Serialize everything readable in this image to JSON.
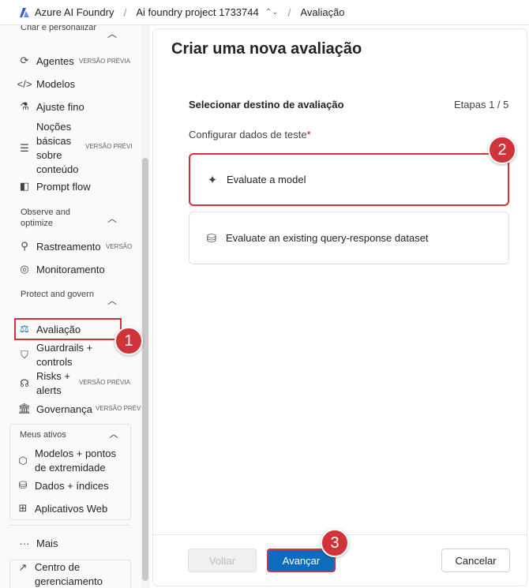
{
  "topbar": {
    "app_name": "Azure AI Foundry",
    "project": "Ai foundry project 1733744",
    "page": "Avaliação"
  },
  "sidebar": {
    "section_build": "Criar e personalizar",
    "items_build": [
      {
        "label": "Agentes",
        "badge": "VERSÃO PRÉVIA",
        "icon": "agents-icon"
      },
      {
        "label": "Modelos",
        "icon": "code-icon"
      },
      {
        "label": "Ajuste fino",
        "icon": "flask-icon"
      },
      {
        "label": "Noções básicas sobre conteúdo",
        "badge": "VERSÃO PRÉVI",
        "icon": "content-icon"
      },
      {
        "label": "Prompt flow",
        "icon": "prompt-flow-icon"
      }
    ],
    "section_observe": "Observe and optimize",
    "items_observe": [
      {
        "label": "Rastreamento",
        "badge": "VERSÃO",
        "icon": "tracing-icon"
      },
      {
        "label": "Monitoramento",
        "icon": "monitor-icon"
      }
    ],
    "section_protect": "Protect and govern",
    "items_protect": [
      {
        "label": "Avaliação",
        "icon": "scale-icon"
      },
      {
        "label": "Guardrails + controls",
        "icon": "shield-icon"
      },
      {
        "label": "Risks + alerts",
        "badge": "VERSÃO PRÉVIA",
        "icon": "risk-icon"
      },
      {
        "label": "Governança",
        "badge": "VERSÃO PRÉVI",
        "icon": "bank-icon"
      }
    ],
    "section_assets": "Meus ativos",
    "items_assets": [
      {
        "label": "Modelos + pontos de extremidade",
        "icon": "cube-icon"
      },
      {
        "label": "Dados + índices",
        "icon": "database-icon"
      },
      {
        "label": "Aplicativos Web",
        "icon": "apps-icon"
      }
    ],
    "more": "Mais",
    "management": "Centro de gerenciamento"
  },
  "main": {
    "title": "Criar uma nova avaliação",
    "step_title": "Selecionar destino de avaliação",
    "step_count": "Etapas 1 / 5",
    "field_label": "Configurar dados de teste",
    "required_mark": "*",
    "options": [
      {
        "label": "Evaluate a model",
        "icon": "sparkle-icon",
        "selected": true
      },
      {
        "label": "Evaluate an existing query-response dataset",
        "icon": "database-icon",
        "selected": false
      }
    ],
    "buttons": {
      "back": "Voltar",
      "next": "Avançar",
      "cancel": "Cancelar"
    }
  },
  "annotations": [
    "1",
    "2",
    "3"
  ],
  "colors": {
    "accent": "#0f6cbd",
    "highlight": "#d13438"
  }
}
